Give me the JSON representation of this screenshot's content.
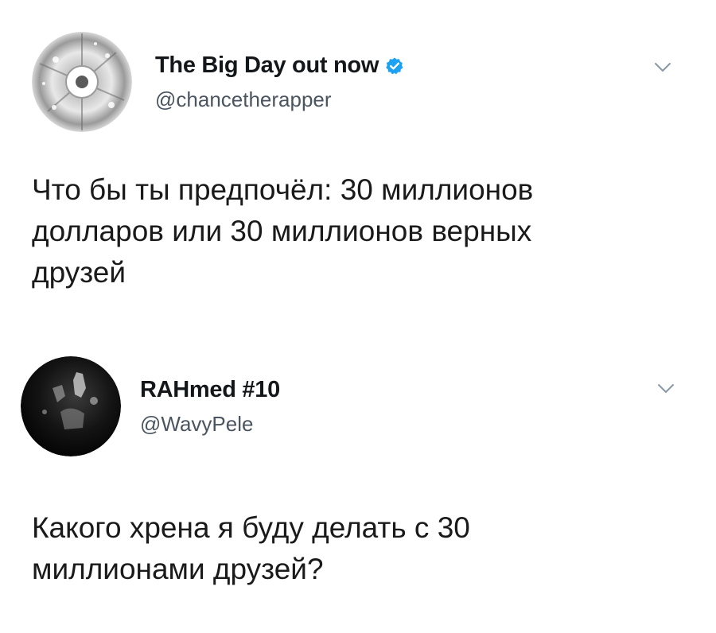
{
  "tweets": [
    {
      "display_name": "The Big Day out now",
      "verified": true,
      "handle": "@chancetherapper",
      "text": "Что бы ты предпочёл: 30 миллионов\nдолларов или 30 миллионов верных\nдрузей",
      "avatar_icon": "cd-disc-avatar",
      "menu_icon": "chevron-down-icon"
    },
    {
      "display_name": "RAHmed #10",
      "verified": false,
      "handle": "@WavyPele",
      "text": "Какого хрена я буду делать с 30\nмиллионами друзей?",
      "avatar_icon": "dark-photo-avatar",
      "menu_icon": "chevron-down-icon"
    }
  ],
  "colors": {
    "verified_blue": "#1da1f2",
    "handle_gray": "#4b5560",
    "text_dark": "#14171a",
    "chevron_gray": "#8899a6"
  }
}
